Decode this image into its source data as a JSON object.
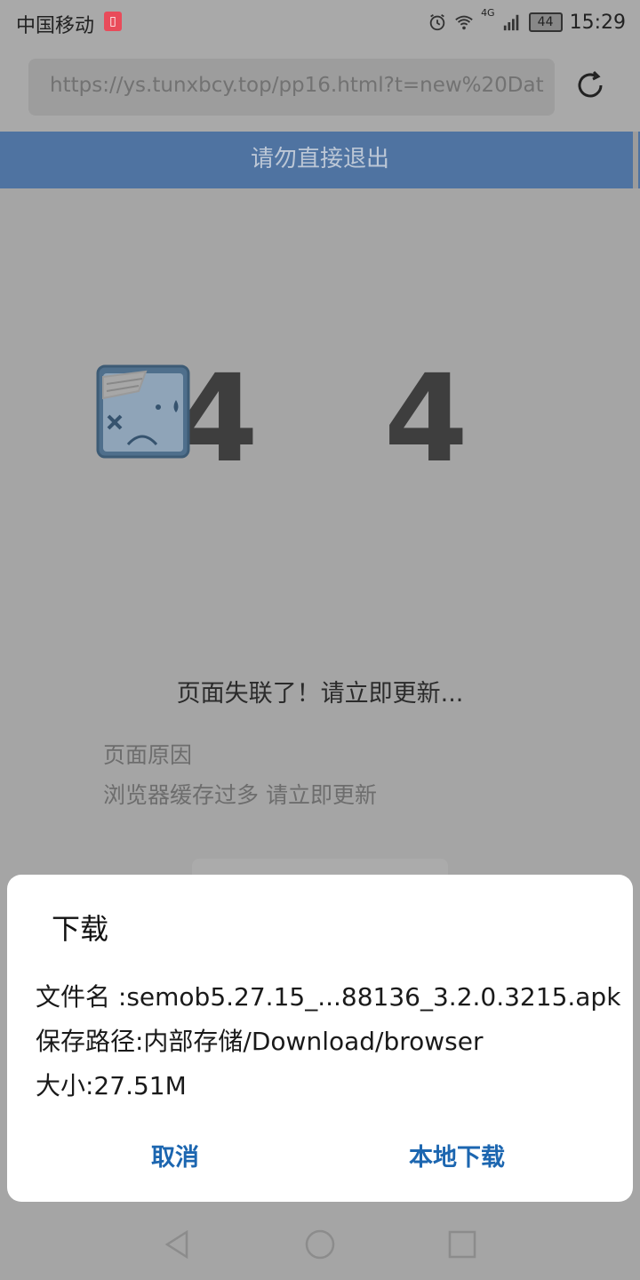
{
  "status_bar": {
    "carrier": "中国移动",
    "network": "4G",
    "battery": "44",
    "time": "15:29",
    "icons": [
      "book-icon",
      "alarm-icon",
      "wifi-icon",
      "signal-icon",
      "battery-icon"
    ]
  },
  "browser": {
    "url": "https://ys.tunxbcy.top/pp16.html?t=new%20Dat",
    "reload_icon": "reload-icon"
  },
  "page": {
    "banner": "请勿直接退出",
    "error_code_left": "4",
    "error_code_right": "4",
    "lost_message": "页面失联了！请立即更新...",
    "reason_title": "页面原因",
    "reason_text": "浏览器缓存过多 请立即更新"
  },
  "dialog": {
    "title": "下载",
    "filename": "文件名 :semob5.27.15_...88136_3.2.0.3215.apk",
    "save_path": "保存路径:内部存储/Download/browser",
    "size": "大小:27.51M",
    "cancel_label": "取消",
    "download_label": "本地下载"
  },
  "nav": {
    "icons": [
      "back-icon",
      "home-icon",
      "recents-icon"
    ]
  },
  "colors": {
    "banner": "#4f73a1",
    "dialog_button": "#1c66b0",
    "overlay": "#a5a5a5"
  }
}
